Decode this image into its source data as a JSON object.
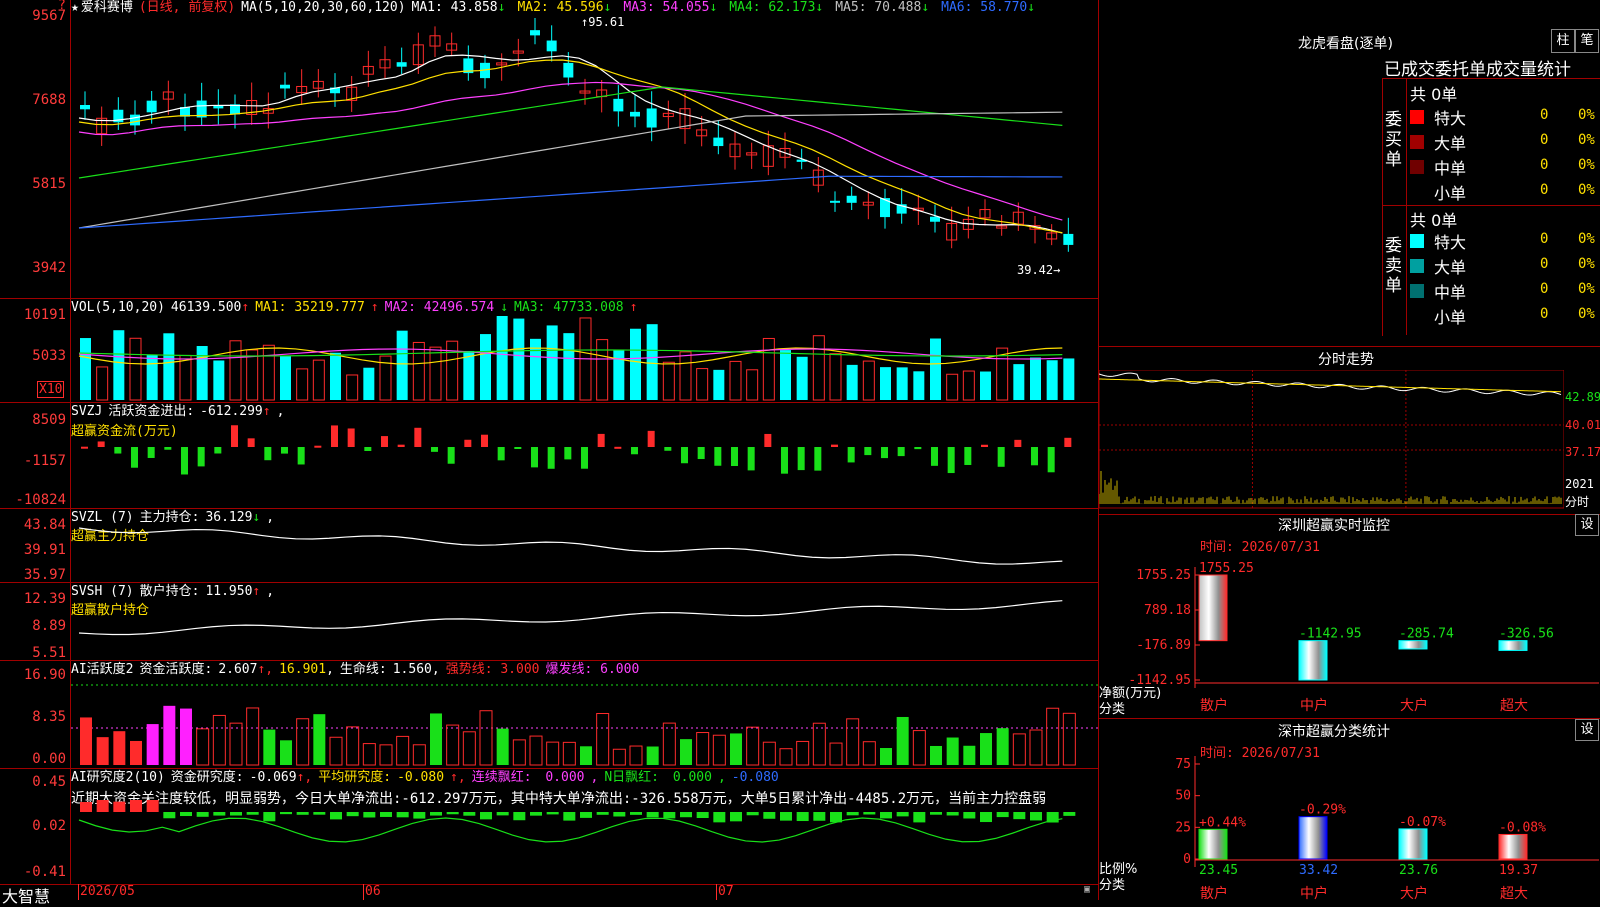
{
  "stock": {
    "star": "★",
    "name": "爱科赛博",
    "mode": "(日线, 前复权)",
    "ma_label": "MA(5,10,20,30,60,120)",
    "ma": [
      {
        "k": "MA1:",
        "v": "43.858",
        "a": "↓",
        "c": "#ffffff"
      },
      {
        "k": "MA2:",
        "v": "45.596",
        "a": "↓",
        "c": "#ffe000"
      },
      {
        "k": "MA3:",
        "v": "54.055",
        "a": "↓",
        "c": "#ff40ff"
      },
      {
        "k": "MA4:",
        "v": "62.173",
        "a": "↓",
        "c": "#19e019"
      },
      {
        "k": "MA5:",
        "v": "70.488",
        "a": "↓",
        "c": "#c0c0c0"
      },
      {
        "k": "MA6:",
        "v": "58.770",
        "a": "↓",
        "c": "#2e6bff"
      }
    ],
    "high_label": "95.61",
    "low_label": "39.42"
  },
  "axes": {
    "price": [
      "9567",
      "7688",
      "5815",
      "3942"
    ],
    "vol": [
      "10191",
      "5033"
    ],
    "vol_mult": "X10",
    "svzj": [
      "8509",
      "-1157",
      "-10824"
    ],
    "svzl": [
      "43.84",
      "39.91",
      "35.97"
    ],
    "svsh": [
      "12.39",
      "8.89",
      "5.51"
    ],
    "ai": [
      "16.90",
      "8.35",
      "0.00"
    ],
    "air": [
      "0.45",
      "0.02",
      "-0.41"
    ]
  },
  "vol": {
    "label": "VOL(5,10,20)",
    "value": "46139.500",
    "a": "↑",
    "ma1": "35219.777",
    "ma1a": "↑",
    "ma2": "42496.574",
    "ma2a": "↓",
    "ma3": "47733.008",
    "ma3a": "↑"
  },
  "svzj": {
    "label": "SVZJ",
    "name": "活跃资金进出:",
    "value": "-612.299",
    "a": "↑",
    "sub": "超赢资金流(万元)"
  },
  "svzl": {
    "label": "SVZL (7)",
    "name": "主力持仓:",
    "value": "36.129",
    "a": "↓",
    "sub": "超赢主力持仓"
  },
  "svsh": {
    "label": "SVSH (7)",
    "name": "散户持仓:",
    "value": "11.950",
    "a": "↑",
    "sub": "超赢散户持仓"
  },
  "ai": {
    "label": "AI活跃度2",
    "name": "资金活跃度:",
    "value": "2.607",
    "v2": "16.901",
    "life_k": "生命线:",
    "life_v": "1.560",
    "strong": "强势线: 3.000",
    "burst": "爆发线: 6.000"
  },
  "air": {
    "label": "AI研究度2(10)",
    "name": "资金研究度:",
    "value": "-0.069",
    "avg_k": "平均研究度:",
    "avg_v": "-0.080",
    "lh_k": "连续飘红:",
    "lh_v": "0.000",
    "nd_k": "N日飘红:",
    "nd_v": "0.000",
    "last": "-0.080",
    "comment": "近期大资金关注度较低，明显弱势，今日大单净流出:-612.297万元，其中特大单净流出:-326.558万元，大单5日累计净出-4485.2万元，当前主力控盘弱"
  },
  "xaxis": {
    "left": "大智慧",
    "dates": [
      "2026/05",
      "06",
      "07"
    ]
  },
  "dragon": {
    "title": "龙虎看盘(逐单)",
    "btn1": "柱",
    "btn2": "笔",
    "stat_title": "已成交委托单成交量统计",
    "buy": {
      "side": "委买单",
      "total": "共 0单",
      "rows": [
        {
          "n": "特大",
          "v": "0",
          "p": "0%",
          "c": "#ff0000"
        },
        {
          "n": "大单",
          "v": "0",
          "p": "0%",
          "c": "#a00000"
        },
        {
          "n": "中单",
          "v": "0",
          "p": "0%",
          "c": "#700000"
        },
        {
          "n": "小单",
          "v": "0",
          "p": "0%",
          "c": "#000000"
        }
      ]
    },
    "sell": {
      "side": "委卖单",
      "total": "共 0单",
      "rows": [
        {
          "n": "特大",
          "v": "0",
          "p": "0%",
          "c": "#00ffff"
        },
        {
          "n": "大单",
          "v": "0",
          "p": "0%",
          "c": "#00a0a0"
        },
        {
          "n": "中单",
          "v": "0",
          "p": "0%",
          "c": "#007070"
        },
        {
          "n": "小单",
          "v": "0",
          "p": "0%",
          "c": "#000000"
        }
      ]
    }
  },
  "timeshare": {
    "title": "分时走势",
    "p1": "42.89",
    "p2": "40.01",
    "p3": "37.17",
    "vol": "2021",
    "vol_unit": "分时"
  },
  "monitor": {
    "title": "深圳超赢实时监控",
    "btn": "设",
    "time": "时间: 2026/07/31",
    "ylab": [
      "1755.25",
      "789.18",
      "-176.89",
      "-1142.95"
    ],
    "unit": "净额(万元)",
    "cls": "分类",
    "bars": [
      {
        "n": "散户",
        "v": "1755.25"
      },
      {
        "n": "中户",
        "v": "-1142.95"
      },
      {
        "n": "大户",
        "v": "-285.74"
      },
      {
        "n": "超大",
        "v": "-326.56"
      }
    ]
  },
  "category": {
    "title": "深市超赢分类统计",
    "btn": "设",
    "time": "时间: 2026/07/31",
    "ylab": [
      "75",
      "50",
      "25",
      "0"
    ],
    "unit": "比例%",
    "cls": "分类",
    "bars": [
      {
        "n": "散户",
        "v": "23.45",
        "d": "+0.44%"
      },
      {
        "n": "中户",
        "v": "33.42",
        "d": "-0.29%"
      },
      {
        "n": "大户",
        "v": "23.76",
        "d": "-0.07%"
      },
      {
        "n": "超大",
        "v": "19.37",
        "d": "-0.08%"
      }
    ]
  }
}
